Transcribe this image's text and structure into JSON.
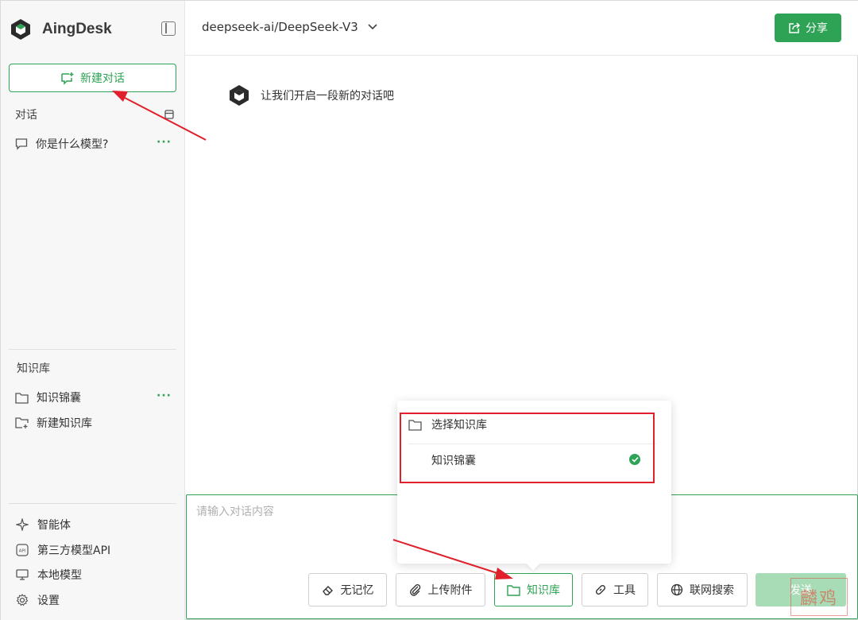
{
  "app": {
    "name": "AingDesk"
  },
  "sidebar": {
    "new_chat_label": "新建对话",
    "conversations_title": "对话",
    "conversations": [
      {
        "label": "你是什么模型?",
        "more": "···"
      }
    ],
    "knowledge_title": "知识库",
    "knowledge_items": [
      {
        "label": "知识锦囊",
        "more": "···",
        "icon": "folder-icon"
      },
      {
        "label": "新建知识库",
        "icon": "folder-add-icon"
      }
    ],
    "bottom_items": [
      {
        "label": "智能体",
        "icon": "sparkle-icon"
      },
      {
        "label": "第三方模型API",
        "icon": "api-icon"
      },
      {
        "label": "本地模型",
        "icon": "monitor-icon"
      },
      {
        "label": "设置",
        "icon": "gear-icon"
      }
    ]
  },
  "header": {
    "model": "deepseek-ai/DeepSeek-V3",
    "share_label": "分享"
  },
  "chat": {
    "welcome": "让我们开启一段新的对话吧"
  },
  "input": {
    "placeholder": "请输入对话内容",
    "tools": [
      {
        "label": "无记忆",
        "icon": "eraser-icon"
      },
      {
        "label": "上传附件",
        "icon": "paperclip-icon"
      },
      {
        "label": "知识库",
        "icon": "folder-icon",
        "active": true
      },
      {
        "label": "工具",
        "icon": "link-icon"
      },
      {
        "label": "联网搜索",
        "icon": "globe-icon"
      }
    ],
    "send_label": "发送"
  },
  "kb_popover": {
    "title": "选择知识库",
    "options": [
      {
        "label": "知识锦囊",
        "selected": true
      }
    ]
  },
  "watermark": "麟鸡",
  "colors": {
    "accent": "#2ea355",
    "annotation": "#e0202a"
  }
}
